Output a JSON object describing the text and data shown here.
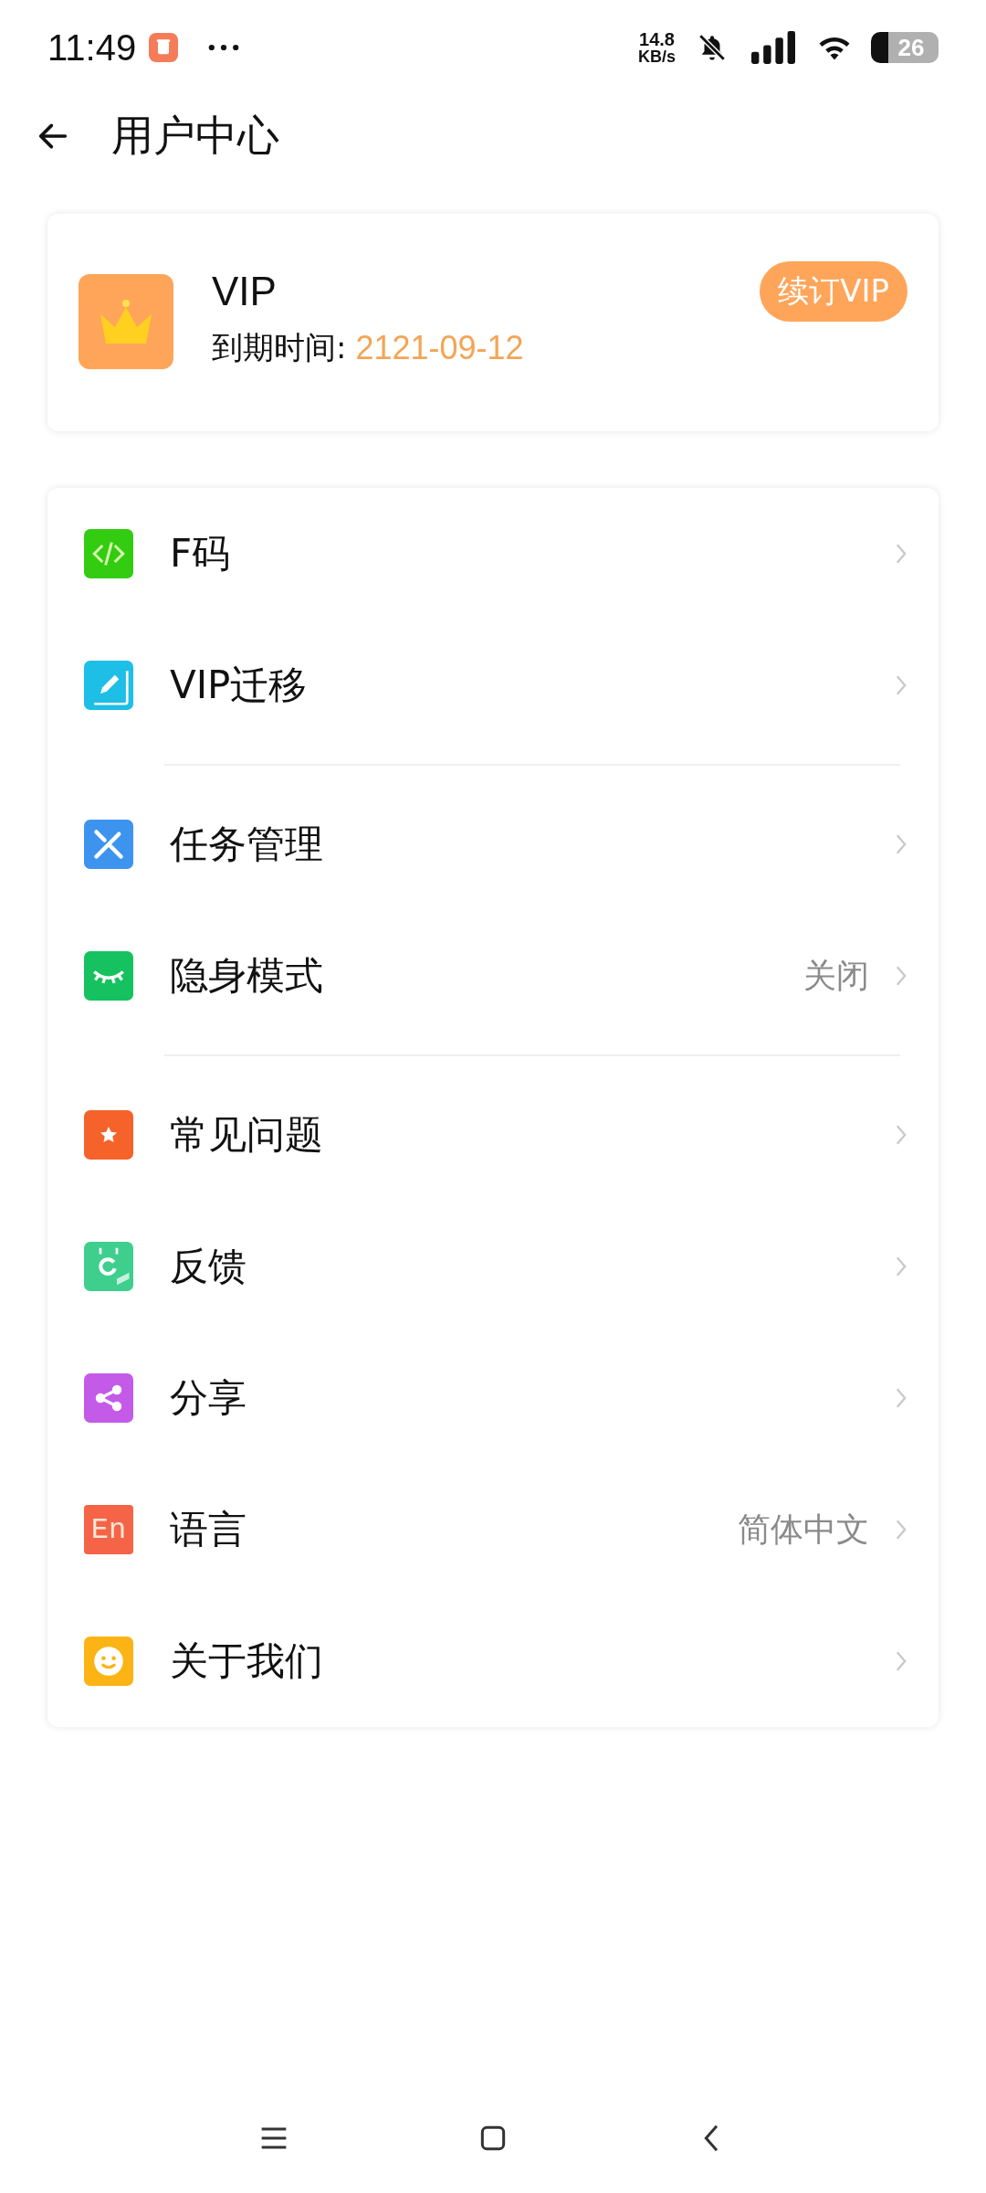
{
  "status_bar": {
    "time": "11:49",
    "speed_value": "14.8",
    "speed_unit": "KB/s",
    "battery": "26"
  },
  "header": {
    "title": "用户中心"
  },
  "vip_card": {
    "title": "VIP",
    "expiry_label": "到期时间:",
    "expiry_date": "2121-09-12",
    "renew_button": "续订VIP"
  },
  "menu_groups": [
    {
      "items": [
        {
          "kind": "code",
          "color": "#33cc11",
          "label": "F码"
        },
        {
          "kind": "book",
          "color": "#1ebfe6",
          "label": "VIP迁移"
        }
      ]
    },
    {
      "items": [
        {
          "kind": "tools",
          "color": "#3d94ee",
          "label": "任务管理"
        },
        {
          "kind": "eye",
          "color": "#15c25f",
          "label": "隐身模式",
          "value": "关闭"
        }
      ]
    },
    {
      "items": [
        {
          "kind": "star",
          "color": "#f5622a",
          "label": "常见问题"
        },
        {
          "kind": "calendar",
          "color": "#3ecf8e",
          "label": "反馈"
        },
        {
          "kind": "share",
          "color": "#c35be8",
          "label": "分享"
        },
        {
          "kind": "text",
          "color": "#f56446",
          "label": "语言",
          "icon_text": "En",
          "value": "简体中文"
        },
        {
          "kind": "smile",
          "color": "#fbb414",
          "label": "关于我们"
        }
      ]
    }
  ]
}
